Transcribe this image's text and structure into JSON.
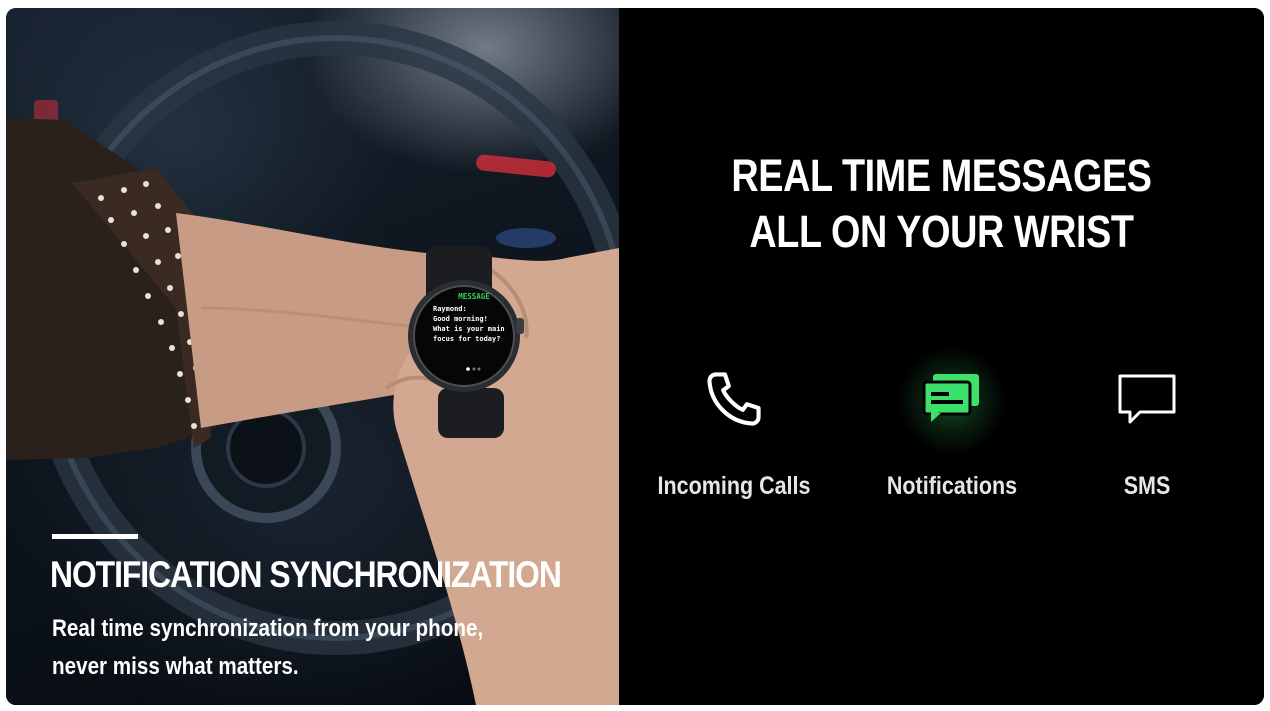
{
  "photo": {
    "watch_screen": {
      "header": "MESSAGE",
      "lines": [
        "Raymond:",
        "Good morning!",
        "What is your main",
        "focus for today?"
      ]
    },
    "caption": {
      "title": "NOTIFICATION SYNCHRONIZATION",
      "subtitle": "Real time synchronization from your phone, never miss what matters."
    }
  },
  "promo": {
    "headline_line1": "REAL TIME MESSAGES",
    "headline_line2": "ALL ON YOUR WRIST",
    "features": [
      {
        "label": "Incoming Calls",
        "icon": "phone-icon",
        "color": "#ffffff"
      },
      {
        "label": "Notifications",
        "icon": "chat-bubbles-icon",
        "color": "#3de06a"
      },
      {
        "label": "SMS",
        "icon": "speech-bubble-icon",
        "color": "#ffffff"
      }
    ]
  },
  "colors": {
    "accent_green": "#3de06a",
    "panel_background": "#000000"
  }
}
